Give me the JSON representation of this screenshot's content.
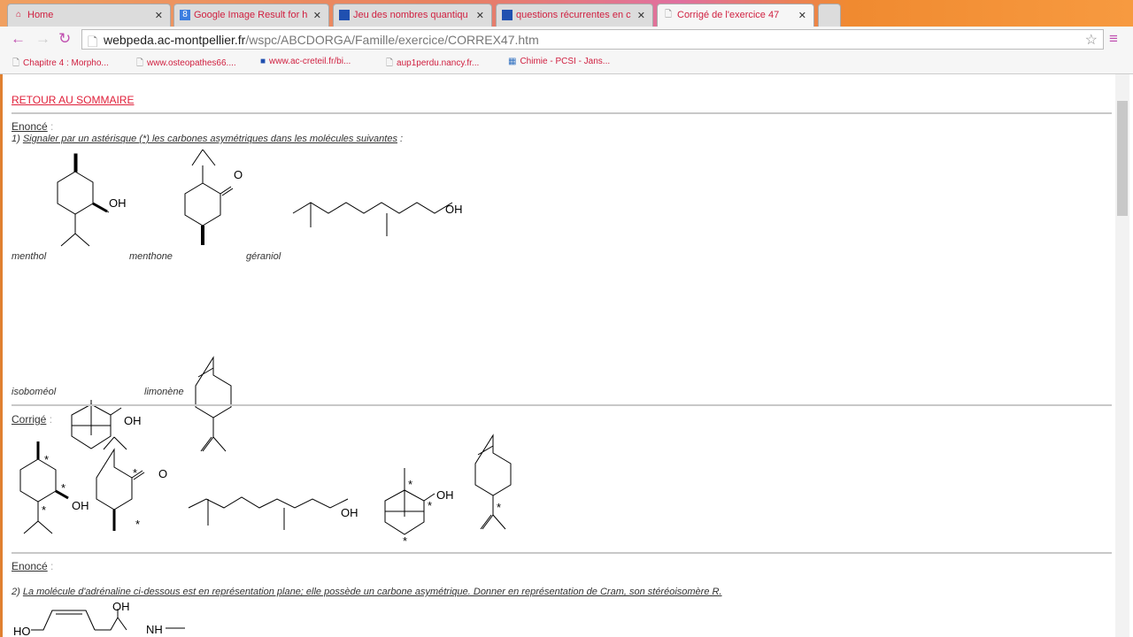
{
  "tabs": [
    {
      "label": "Home",
      "icon": "home-icon"
    },
    {
      "label": "Google Image Result for h",
      "icon": "google-icon"
    },
    {
      "label": "Jeu des nombres quantiqu",
      "icon": "site-icon"
    },
    {
      "label": "questions récurrentes en c",
      "icon": "site-icon"
    },
    {
      "label": "Corrigé de l'exercice 47",
      "icon": "page-icon"
    }
  ],
  "url": {
    "host": "webpeda.ac-montpellier.fr",
    "path": "/wspc/ABCDORGA/Famille/exercice/CORREX47.htm"
  },
  "bookmarks": [
    "Chapitre 4 : Morpho...",
    "www.osteopathes66....",
    "www.ac-creteil.fr/bi...",
    "aup1perdu.nancy.fr...",
    "Chimie - PCSI - Jans..."
  ],
  "page": {
    "back_link": "RETOUR AU SOMMAIRE",
    "enonce": "Enoncé",
    "colon": " :",
    "q1": "1) ",
    "q1_text": "Signaler par un astérisque (*) les carbones asymétriques dans les molécules suivantes",
    "names": [
      "menthol",
      "menthone",
      "géraniol",
      "isoboméol",
      "limonène"
    ],
    "corrige": "Corrigé",
    "enonce2": "Enoncé",
    "q2": "2) ",
    "q2_text": "La molécule d'adrénaline ci-dessous est en représentation plane; elle possède un carbone asymétrique. Donner en représentation de Cram, son stéréoisomère R.",
    "labels": {
      "oh": "OH",
      "o": "O",
      "star": "*",
      "ho": "HO",
      "nh": "NH"
    }
  }
}
